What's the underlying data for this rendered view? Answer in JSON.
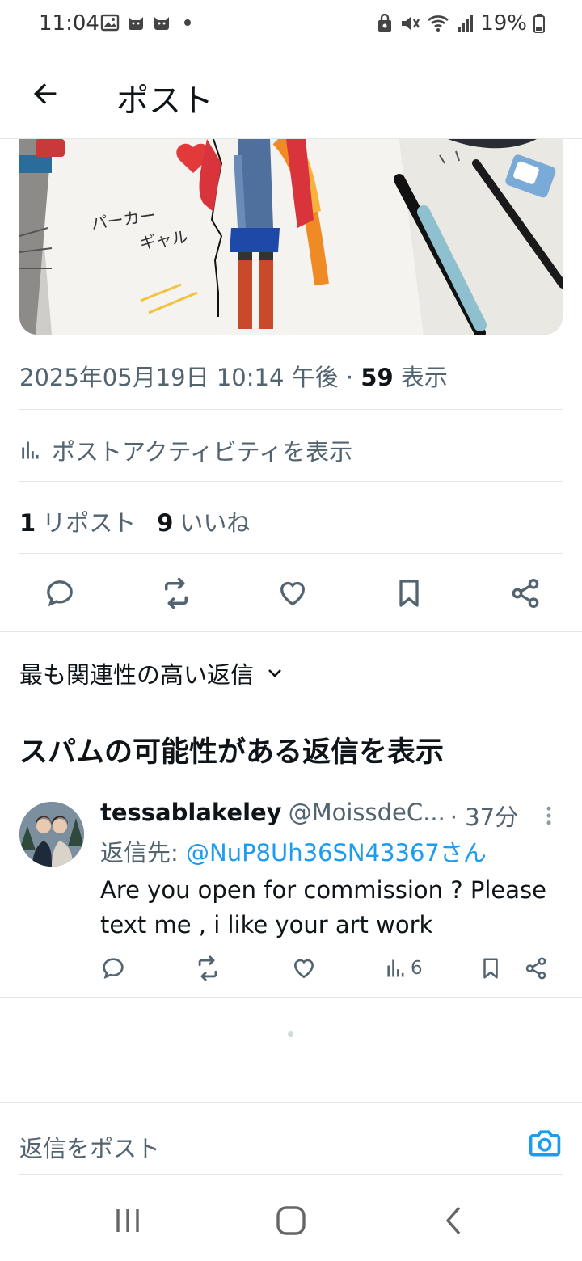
{
  "status_bar": {
    "time": "11:04",
    "battery": "19%",
    "left_icons": [
      "image-icon",
      "cat-icon",
      "cat-icon",
      "dot-icon"
    ],
    "right_icons": [
      "recycle-lock-icon",
      "mute-icon",
      "wifi-icon",
      "signal-icon",
      "battery-icon"
    ]
  },
  "header": {
    "title": "ポスト"
  },
  "post": {
    "timestamp": "2025年05月19日 10:14 午後 · ",
    "views_count": "59",
    "views_label": " 表示",
    "activity_label": "ポストアクティビティを表示",
    "reposts_count": "1",
    "reposts_label": "リポスト",
    "likes_count": "9",
    "likes_label": "いいね",
    "image_text": "パーカー\nギャル"
  },
  "replies": {
    "sort_label": "最も関連性の高い返信",
    "spam_label": "スパムの可能性がある返信を表示",
    "items": [
      {
        "name": "tessablakeley",
        "handle": "@MoissdeC...",
        "time": "· 37分",
        "reply_to_prefix": "返信先: ",
        "reply_to_mention": "@NuP8Uh36SN43367さん",
        "text": "Are you open for commission ? Please text me , i like your art work",
        "views": "6"
      }
    ]
  },
  "compose": {
    "placeholder": "返信をポスト"
  },
  "colors": {
    "accent": "#1d9bf0",
    "text_primary": "#0f1419",
    "text_secondary": "#536471",
    "divider": "#e5e7eb"
  }
}
